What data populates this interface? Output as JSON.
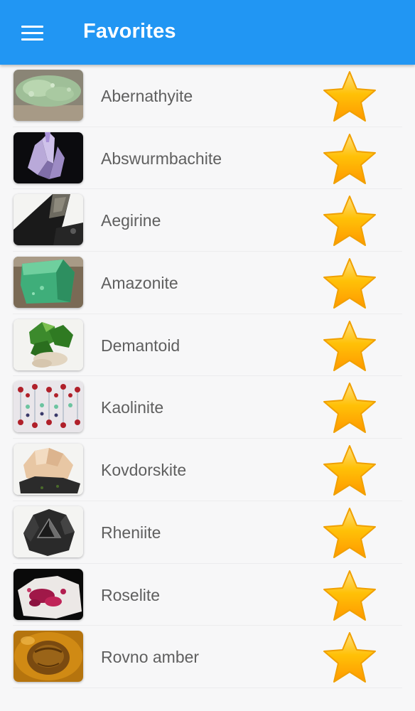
{
  "appbar": {
    "title": "Favorites",
    "menu_icon": "hamburger-menu-icon",
    "color": "#2196f3"
  },
  "favorites": [
    {
      "name": "Abernathyite",
      "icon": "star-icon",
      "favorited": true
    },
    {
      "name": "Abswurmbachite",
      "icon": "star-icon",
      "favorited": true
    },
    {
      "name": "Aegirine",
      "icon": "star-icon",
      "favorited": true
    },
    {
      "name": "Amazonite",
      "icon": "star-icon",
      "favorited": true
    },
    {
      "name": "Demantoid",
      "icon": "star-icon",
      "favorited": true
    },
    {
      "name": "Kaolinite",
      "icon": "star-icon",
      "favorited": true
    },
    {
      "name": "Kovdorskite",
      "icon": "star-icon",
      "favorited": true
    },
    {
      "name": "Rheniite",
      "icon": "star-icon",
      "favorited": true
    },
    {
      "name": "Roselite",
      "icon": "star-icon",
      "favorited": true
    },
    {
      "name": "Rovno amber",
      "icon": "star-icon",
      "favorited": true
    }
  ],
  "colors": {
    "star_top": "#ffd54f",
    "star_bottom": "#ff9800",
    "text": "#5f5f5f"
  }
}
